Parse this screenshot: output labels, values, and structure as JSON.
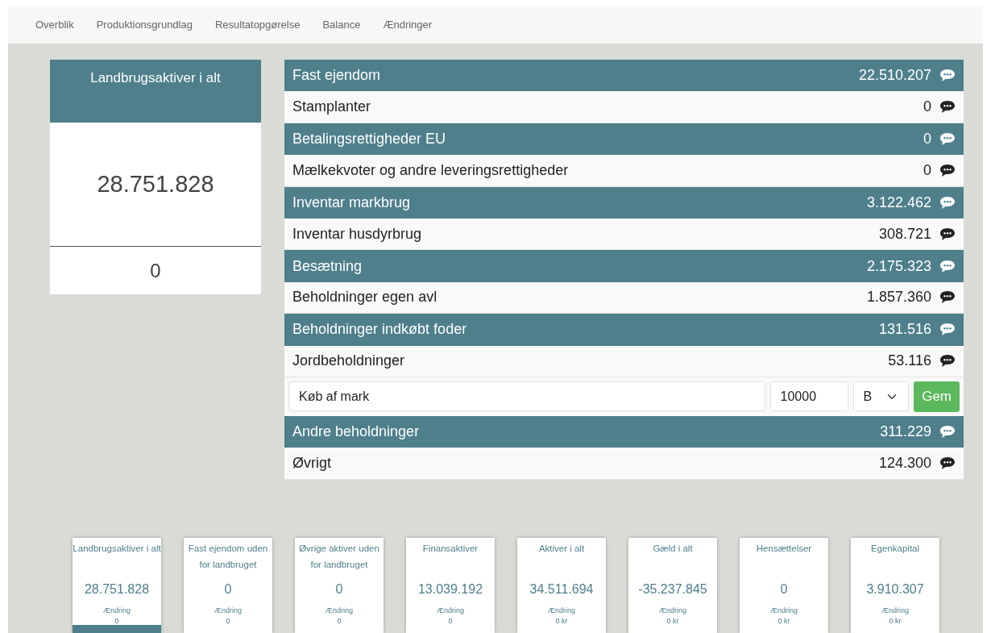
{
  "nav": [
    {
      "label": "Overblik"
    },
    {
      "label": "Produktionsgrundlag"
    },
    {
      "label": "Resultatopgørelse"
    },
    {
      "label": "Balance"
    },
    {
      "label": "Ændringer"
    }
  ],
  "summary": {
    "title": "Landbrugsaktiver i alt",
    "value": "28.751.828",
    "secondary": "0"
  },
  "rows": [
    {
      "kind": "row",
      "label": "Fast ejendom",
      "value": "22.510.207"
    },
    {
      "kind": "row",
      "label": "Stamplanter",
      "value": "0"
    },
    {
      "kind": "row",
      "label": "Betalingsrettigheder EU",
      "value": "0"
    },
    {
      "kind": "row",
      "label": "Mælkekvoter og andre leveringsrettigheder",
      "value": "0"
    },
    {
      "kind": "row",
      "label": "Inventar markbrug",
      "value": "3.122.462"
    },
    {
      "kind": "row",
      "label": "Inventar husdyrbrug",
      "value": "308.721"
    },
    {
      "kind": "row",
      "label": "Besætning",
      "value": "2.175.323"
    },
    {
      "kind": "row",
      "label": "Beholdninger egen avl",
      "value": "1.857.360"
    },
    {
      "kind": "row",
      "label": "Beholdninger indkøbt foder",
      "value": "131.516"
    },
    {
      "kind": "row",
      "label": "Jordbeholdninger",
      "value": "53.116"
    },
    {
      "kind": "editor",
      "text": "Køb af mark",
      "amount": "10000",
      "option": "B",
      "button": "Gem"
    },
    {
      "kind": "row",
      "label": "Andre beholdninger",
      "value": "311.229"
    },
    {
      "kind": "row",
      "label": "Øvrigt",
      "value": "124.300"
    }
  ],
  "cards": [
    {
      "title": "Landbrugsaktiver i alt",
      "value": "28.751.828",
      "change_label": "Ændring",
      "change": "0",
      "selected": true
    },
    {
      "title": "Fast ejendom uden for landbruget",
      "value": "0",
      "change_label": "Ændring",
      "change": "0",
      "selected": false
    },
    {
      "title": "Øvrige aktiver uden for landbruget",
      "value": "0",
      "change_label": "Ændring",
      "change": "0",
      "selected": false
    },
    {
      "title": "Finansaktiver",
      "value": "13.039.192",
      "change_label": "Ændring",
      "change": "0",
      "selected": false
    },
    {
      "title": "Aktiver i alt",
      "value": "34.511.694",
      "change_label": "Ændring",
      "change": "0 kr",
      "selected": false
    },
    {
      "title": "Gæld i alt",
      "value": "-35.237.845",
      "change_label": "Ændring",
      "change": "0 kr",
      "selected": false
    },
    {
      "title": "Hensættelser",
      "value": "0",
      "change_label": "Ændring",
      "change": "0 kr",
      "selected": false
    },
    {
      "title": "Egenkapital",
      "value": "3.910.307",
      "change_label": "Ændring",
      "change": "0 kr",
      "selected": false
    }
  ]
}
